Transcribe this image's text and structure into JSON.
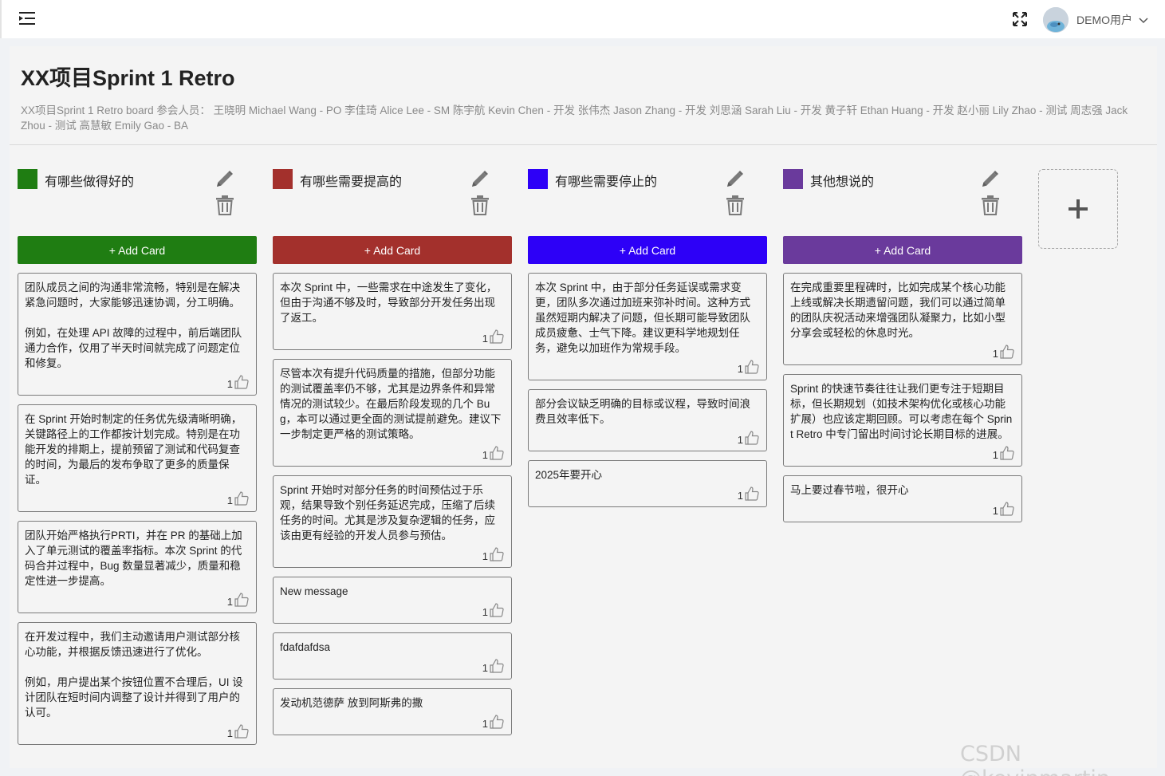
{
  "header": {
    "menu_icon": "menu-fold-icon",
    "fullscreen_icon": "fullscreen-icon",
    "user_name": "DEMO用户",
    "dropdown_icon": "chevron-down-icon"
  },
  "board": {
    "title": "XX项目Sprint 1 Retro",
    "description": "XX项目Sprint 1 Retro board 参会人员： 王晓明 Michael Wang - PO 李佳琦 Alice Lee - SM 陈宇航 Kevin Chen - 开发 张伟杰 Jason Zhang - 开发 刘思涵 Sarah Liu - 开发 黄子轩 Ethan Huang - 开发 赵小丽 Lily Zhao - 测试 周志强 Jack Zhou - 测试 高慧敏 Emily Gao - BA"
  },
  "add_column_icon": "plus-icon",
  "columns": [
    {
      "title": "有哪些做得好的",
      "color": "#1f7d12",
      "add_label": "+ Add Card",
      "cards": [
        {
          "text": "团队成员之间的沟通非常流畅，特别是在解决紧急问题时，大家能够迅速协调，分工明确。\n\n例如，在处理 API 故障的过程中，前后端团队通力合作，仅用了半天时间就完成了问题定位和修复。",
          "likes": "1"
        },
        {
          "text": "在 Sprint 开始时制定的任务优先级清晰明确，关键路径上的工作都按计划完成。特别是在功能开发的排期上，提前预留了测试和代码复查的时间，为最后的发布争取了更多的质量保证。",
          "likes": "1"
        },
        {
          "text": "团队开始严格执行PRTI，并在 PR 的基础上加入了单元测试的覆盖率指标。本次 Sprint 的代码合并过程中，Bug 数量显著减少，质量和稳定性进一步提高。",
          "likes": "1"
        },
        {
          "text": "在开发过程中，我们主动邀请用户测试部分核心功能，并根据反馈迅速进行了优化。\n\n例如，用户提出某个按钮位置不合理后，UI 设计团队在短时间内调整了设计并得到了用户的认可。",
          "likes": "1"
        }
      ]
    },
    {
      "title": "有哪些需要提高的",
      "color": "#a3302c",
      "add_label": "+ Add Card",
      "cards": [
        {
          "text": "本次 Sprint 中，一些需求在中途发生了变化，但由于沟通不够及时，导致部分开发任务出现了返工。",
          "likes": "1"
        },
        {
          "text": "尽管本次有提升代码质量的措施，但部分功能的测试覆盖率仍不够，尤其是边界条件和异常情况的测试较少。在最后阶段发现的几个 Bug，本可以通过更全面的测试提前避免。建议下一步制定更严格的测试策略。",
          "likes": "1"
        },
        {
          "text": "Sprint 开始时对部分任务的时间预估过于乐观，结果导致个别任务延迟完成，压缩了后续任务的时间。尤其是涉及复杂逻辑的任务，应该由更有经验的开发人员参与预估。",
          "likes": "1"
        },
        {
          "text": "New message",
          "likes": "1"
        },
        {
          "text": "fdafdafdsa",
          "likes": "1"
        },
        {
          "text": "发动机范德萨 放到阿斯弗的撒",
          "likes": "1"
        }
      ]
    },
    {
      "title": "有哪些需要停止的",
      "color": "#2d00f7",
      "add_label": "+ Add Card",
      "cards": [
        {
          "text": "本次 Sprint 中，由于部分任务延误或需求变更，团队多次通过加班来弥补时间。这种方式虽然短期内解决了问题，但长期可能导致团队成员疲惫、士气下降。建议更科学地规划任务，避免以加班作为常规手段。",
          "likes": "1"
        },
        {
          "text": "部分会议缺乏明确的目标或议程，导致时间浪费且效率低下。",
          "likes": "1"
        },
        {
          "text": "2025年要开心",
          "likes": "1"
        }
      ]
    },
    {
      "title": "其他想说的",
      "color": "#6a3a9c",
      "add_label": "+ Add Card",
      "cards": [
        {
          "text": "在完成重要里程碑时，比如完成某个核心功能上线或解决长期遗留问题，我们可以通过简单的团队庆祝活动来增强团队凝聚力，比如小型分享会或轻松的休息时光。",
          "likes": "1"
        },
        {
          "text": "Sprint 的快速节奏往往让我们更专注于短期目标，但长期规划（如技术架构优化或核心功能扩展）也应该定期回顾。可以考虑在每个 Sprint Retro 中专门留出时间讨论长期目标的进展。",
          "likes": "1"
        },
        {
          "text": "马上要过春节啦，很开心",
          "likes": "1"
        }
      ]
    }
  ],
  "watermark": "CSDN @kevinmartin"
}
